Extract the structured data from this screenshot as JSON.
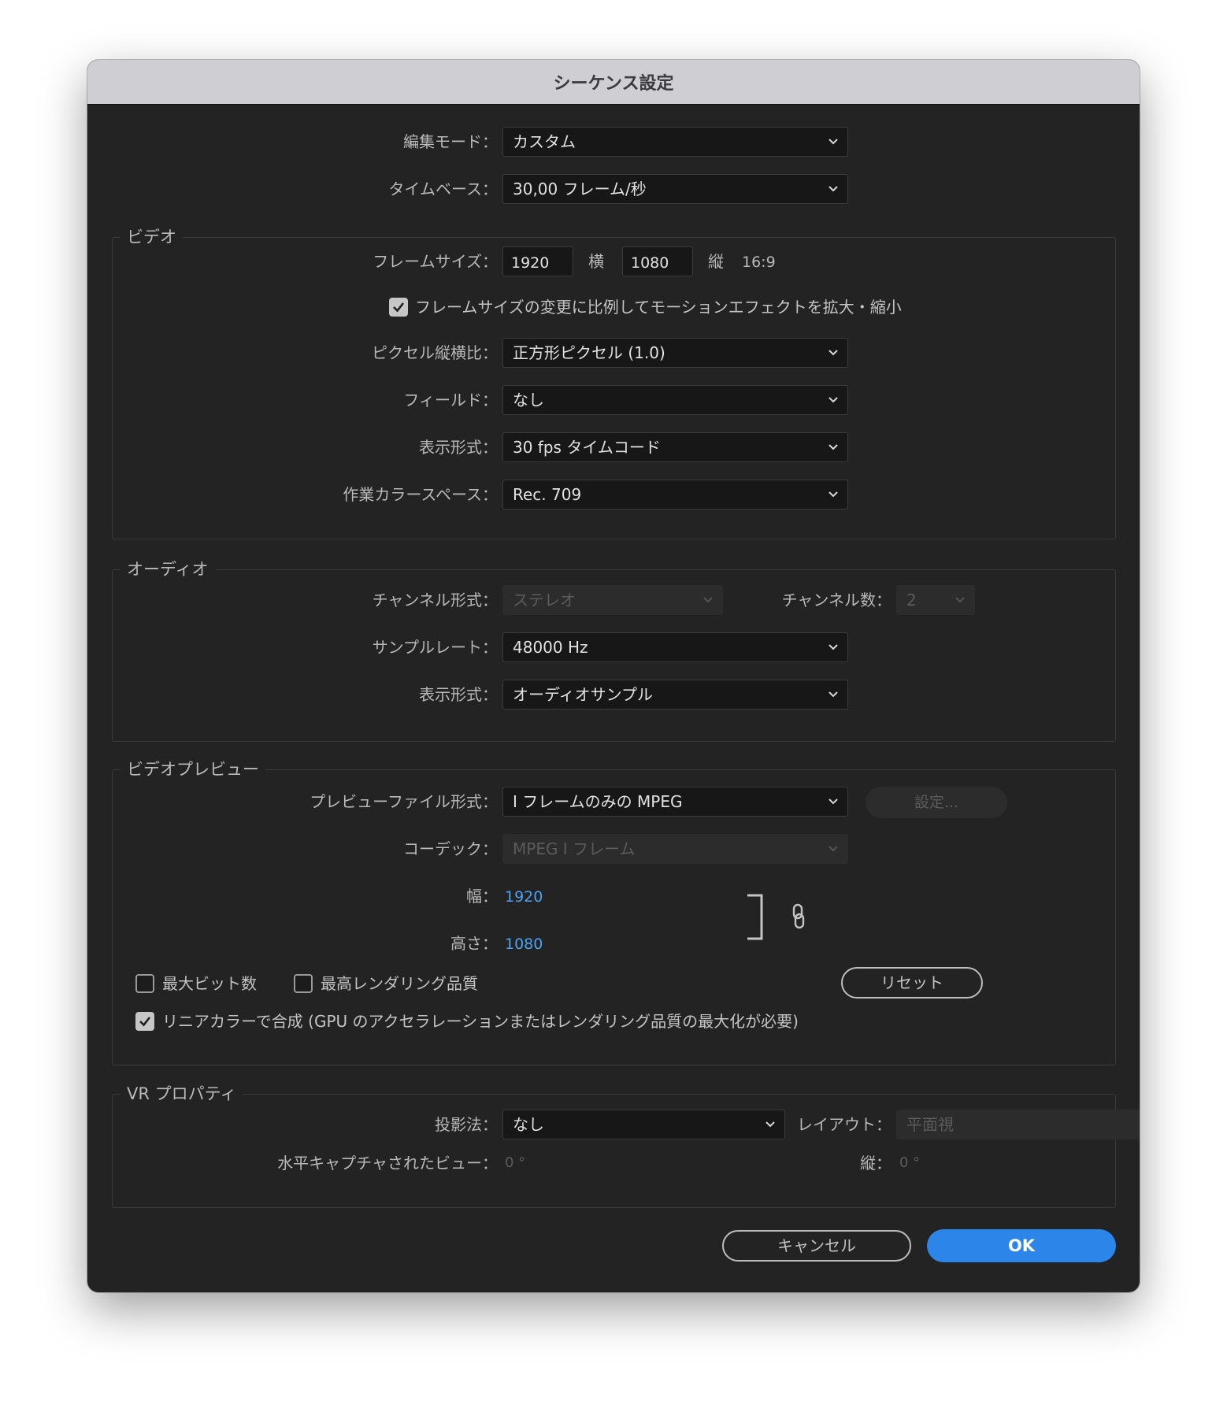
{
  "window": {
    "title": "シーケンス設定"
  },
  "top": {
    "edit_mode": {
      "label": "編集モード：",
      "value": "カスタム"
    },
    "timebase": {
      "label": "タイムベース：",
      "value": "30,00  フレーム/秒"
    }
  },
  "video": {
    "title": "ビデオ",
    "frame_size": {
      "label": "フレームサイズ：",
      "width": "1920",
      "width_unit": "横",
      "height": "1080",
      "height_unit": "縦",
      "aspect": "16:9"
    },
    "scale_checkbox": {
      "label": "フレームサイズの変更に比例してモーションエフェクトを拡大・縮小",
      "checked": true
    },
    "pixel_aspect": {
      "label": "ピクセル縦横比：",
      "value": "正方形ピクセル (1.0)"
    },
    "fields": {
      "label": "フィールド：",
      "value": "なし"
    },
    "display_format": {
      "label": "表示形式：",
      "value": "30 fps タイムコード"
    },
    "color_space": {
      "label": "作業カラースペース：",
      "value": "Rec. 709"
    }
  },
  "audio": {
    "title": "オーディオ",
    "channel_format": {
      "label": "チャンネル形式：",
      "value": "ステレオ"
    },
    "channel_count": {
      "label": "チャンネル数：",
      "value": "2"
    },
    "sample_rate": {
      "label": "サンプルレート：",
      "value": "48000 Hz"
    },
    "display_format": {
      "label": "表示形式：",
      "value": "オーディオサンプル"
    }
  },
  "preview": {
    "title": "ビデオプレビュー",
    "file_format": {
      "label": "プレビューファイル形式：",
      "value": "I フレームのみの MPEG"
    },
    "settings_button": "設定...",
    "codec": {
      "label": "コーデック：",
      "value": "MPEG I フレーム"
    },
    "width": {
      "label": "幅：",
      "value": "1920"
    },
    "height": {
      "label": "高さ：",
      "value": "1080"
    },
    "reset_button": "リセット",
    "max_bit_depth": {
      "label": "最大ビット数",
      "checked": false
    },
    "max_render_quality": {
      "label": "最高レンダリング品質",
      "checked": false
    },
    "linear_color": {
      "label": "リニアカラーで合成 (GPU のアクセラレーションまたはレンダリング品質の最大化が必要)",
      "checked": true
    }
  },
  "vr": {
    "title": "VR プロパティ",
    "projection": {
      "label": "投影法：",
      "value": "なし"
    },
    "layout": {
      "label": "レイアウト：",
      "value": "平面視"
    },
    "h_view": {
      "label": "水平キャプチャされたビュー：",
      "value": "0 °"
    },
    "v_view": {
      "label": "縦：",
      "value": "0 °"
    }
  },
  "footer": {
    "cancel": "キャンセル",
    "ok": "OK"
  }
}
